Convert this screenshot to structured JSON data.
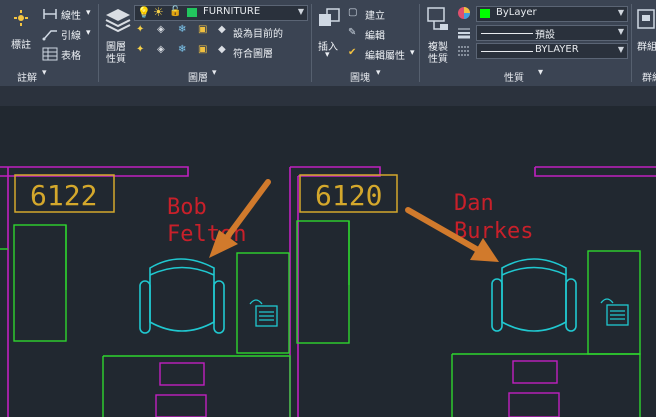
{
  "ribbon": {
    "annotation": {
      "dimension_label": "標註",
      "linear_label": "線性",
      "leader_label": "引線",
      "table_label": "表格",
      "panel_title": "註解"
    },
    "layers": {
      "layer_props_label_1": "圖層",
      "layer_props_label_2": "性質",
      "current_layer": "FURNITURE",
      "set_current_label": "設為目前的",
      "match_layer_label": "符合圖層",
      "panel_title": "圖層"
    },
    "block": {
      "insert_label": "插入",
      "create_label": "建立",
      "edit_label": "編輯",
      "edit_attributes_label": "編輯屬性",
      "panel_title": "圖塊"
    },
    "properties": {
      "match_props_label_1": "複製",
      "match_props_label_2": "性質",
      "color_value": "ByLayer",
      "linetype_value": "預設",
      "lineweight_value": "BYLAYER",
      "panel_title": "性質",
      "groups_label": "群組",
      "groups_panel_title": "群組"
    },
    "colors": {
      "ribbon_bg": "#3b4453",
      "layer_swatch": "#22c55e",
      "bylayer_swatch": "#00ff00"
    }
  },
  "drawing": {
    "room_numbers": [
      "6122",
      "6120"
    ],
    "names": [
      {
        "first": "Bob",
        "last": "Felton"
      },
      {
        "first": "Dan",
        "last": "Burkes"
      }
    ],
    "colors": {
      "walls": "#c020c0",
      "furniture": "#2ed52e",
      "chairs": "#20c8d0",
      "labels": "#d4a82c",
      "names": "#c8202a",
      "arrows": "#d17a2c"
    }
  }
}
